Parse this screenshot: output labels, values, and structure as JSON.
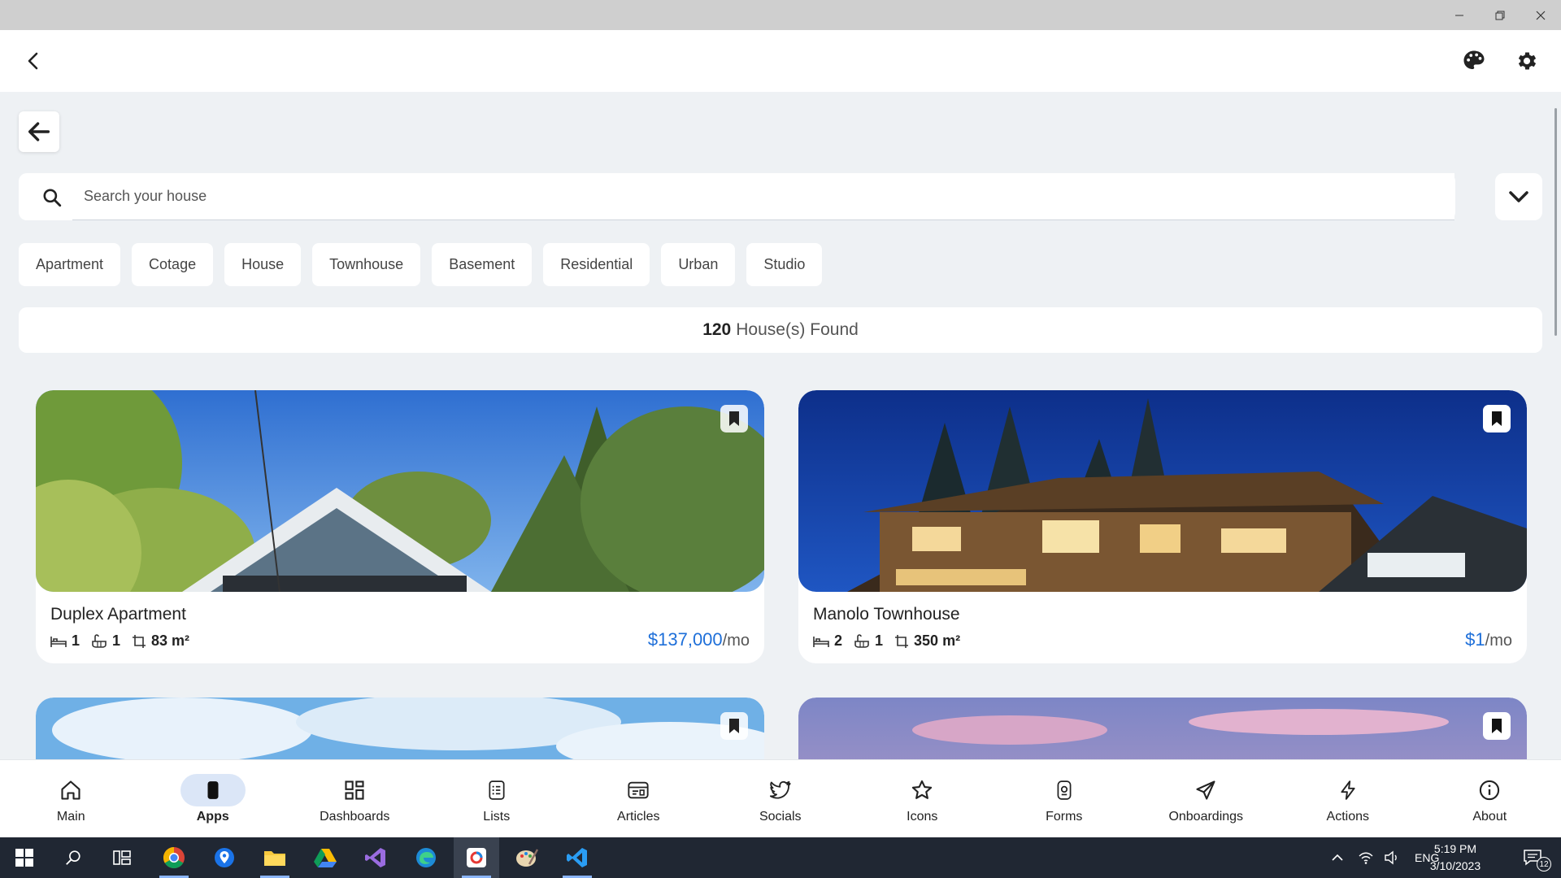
{
  "window": {
    "controls": [
      "minimize",
      "restore",
      "close"
    ]
  },
  "header": {
    "back_icon": "chevron-left-icon",
    "actions": [
      "palette-icon",
      "gear-icon"
    ]
  },
  "search": {
    "placeholder": "Search your house",
    "value": ""
  },
  "chips": [
    "Apartment",
    "Cotage",
    "House",
    "Townhouse",
    "Basement",
    "Residential",
    "Urban",
    "Studio"
  ],
  "results": {
    "count": "120",
    "label": "House(s) Found"
  },
  "listings": [
    {
      "title": "Duplex Apartment",
      "beds": "1",
      "baths": "1",
      "area": "83 m²",
      "price": "$137,000",
      "per": "/mo",
      "image": "sky-trees-house-photo"
    },
    {
      "title": "Manolo Townhouse",
      "beds": "2",
      "baths": "1",
      "area": "350 m²",
      "price": "$1",
      "per": "/mo",
      "image": "night-townhouse-photo"
    },
    {
      "image": "cloudy-sky-photo"
    },
    {
      "image": "sunset-sky-photo"
    }
  ],
  "nav": [
    {
      "label": "Main",
      "icon": "home-icon"
    },
    {
      "label": "Apps",
      "icon": "phone-icon",
      "active": true
    },
    {
      "label": "Dashboards",
      "icon": "grid-icon"
    },
    {
      "label": "Lists",
      "icon": "list-icon"
    },
    {
      "label": "Articles",
      "icon": "article-icon"
    },
    {
      "label": "Socials",
      "icon": "twitter-bird-icon"
    },
    {
      "label": "Icons",
      "icon": "star-icon"
    },
    {
      "label": "Forms",
      "icon": "form-icon"
    },
    {
      "label": "Onboardings",
      "icon": "send-icon"
    },
    {
      "label": "Actions",
      "icon": "lightning-icon"
    },
    {
      "label": "About",
      "icon": "info-icon"
    }
  ],
  "taskbar": {
    "language": "ENG",
    "time": "5:19 PM",
    "date": "3/10/2023",
    "notifications": "12"
  },
  "colors": {
    "accent_price": "#1e6fd9",
    "nav_active_bg": "#dbe6f7",
    "taskbar_bg": "#202733"
  }
}
